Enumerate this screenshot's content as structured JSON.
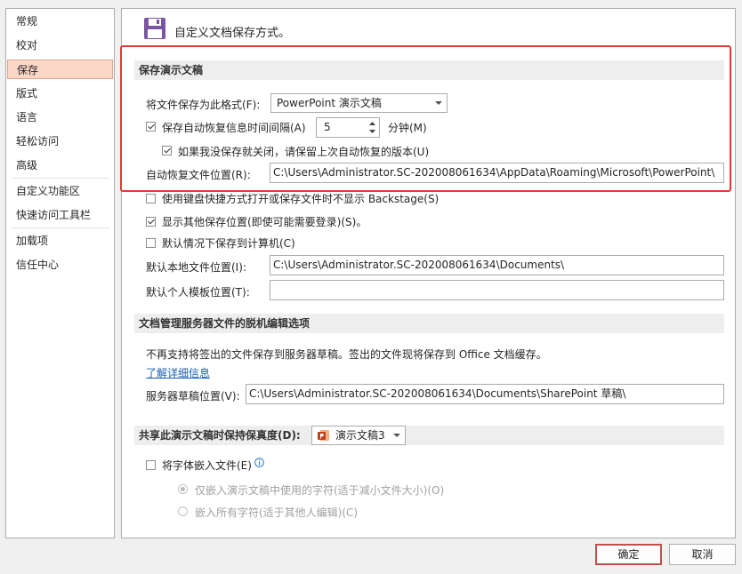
{
  "sidebar": {
    "items": [
      {
        "label": "常规"
      },
      {
        "label": "校对"
      },
      {
        "label": "保存",
        "selected": true
      },
      {
        "label": "版式"
      },
      {
        "label": "语言"
      },
      {
        "label": "轻松访问"
      },
      {
        "label": "高级"
      },
      {
        "label": "自定义功能区"
      },
      {
        "label": "快速访问工具栏"
      },
      {
        "label": "加载项"
      },
      {
        "label": "信任中心"
      }
    ]
  },
  "header": {
    "title": "自定义文档保存方式。",
    "icon": "floppy-disk-icon"
  },
  "save_section": {
    "title": "保存演示文稿",
    "format_label": "将文件保存为此格式(F):",
    "format_value": "PowerPoint 演示文稿",
    "autorecover_label": "保存自动恢复信息时间间隔(A)",
    "autorecover_checked": true,
    "autorecover_minutes": "5",
    "minutes_label": "分钟(M)",
    "keep_last_label": "如果我没保存就关闭，请保留上次自动恢复的版本(U)",
    "keep_last_checked": true,
    "autorecover_location_label": "自动恢复文件位置(R):",
    "autorecover_location_value": "C:\\Users\\Administrator.SC-202008061634\\AppData\\Roaming\\Microsoft\\PowerPoint\\",
    "shortcuts_label": "使用键盘快捷方式打开或保存文件时不显示 Backstage(S)",
    "shortcuts_checked": false,
    "show_other_label": "显示其他保存位置(即使可能需要登录)(S)。",
    "show_other_checked": true,
    "save_to_computer_label": "默认情况下保存到计算机(C)",
    "save_to_computer_checked": false,
    "default_local_label": "默认本地文件位置(I):",
    "default_local_value": "C:\\Users\\Administrator.SC-202008061634\\Documents\\",
    "default_template_label": "默认个人模板位置(T):",
    "default_template_value": ""
  },
  "offline_section": {
    "title": "文档管理服务器文件的脱机编辑选项",
    "description": "不再支持将签出的文件保存到服务器草稿。签出的文件现将保存到 Office 文档缓存。",
    "learn_more": "了解详细信息",
    "drafts_label": "服务器草稿位置(V):",
    "drafts_value": "C:\\Users\\Administrator.SC-202008061634\\Documents\\SharePoint 草稿\\"
  },
  "fidelity_section": {
    "title": "共享此演示文稿时保持保真度(D):",
    "document_value": "演示文稿3",
    "document_icon": "powerpoint-icon",
    "embed_fonts_label": "将字体嵌入文件(E)",
    "embed_fonts_checked": false,
    "info_icon": "info-icon",
    "embed_used_label": "仅嵌入演示文稿中使用的字符(适于减小文件大小)(O)",
    "embed_used_selected": true,
    "embed_all_label": "嵌入所有字符(适于其他人编辑)(C)",
    "embed_all_selected": false
  },
  "footer": {
    "ok_label": "确定",
    "cancel_label": "取消"
  },
  "colors": {
    "highlight_box": "#e53935",
    "nav_selected_bg": "#fbd7c8",
    "ok_border": "#c0504d"
  }
}
